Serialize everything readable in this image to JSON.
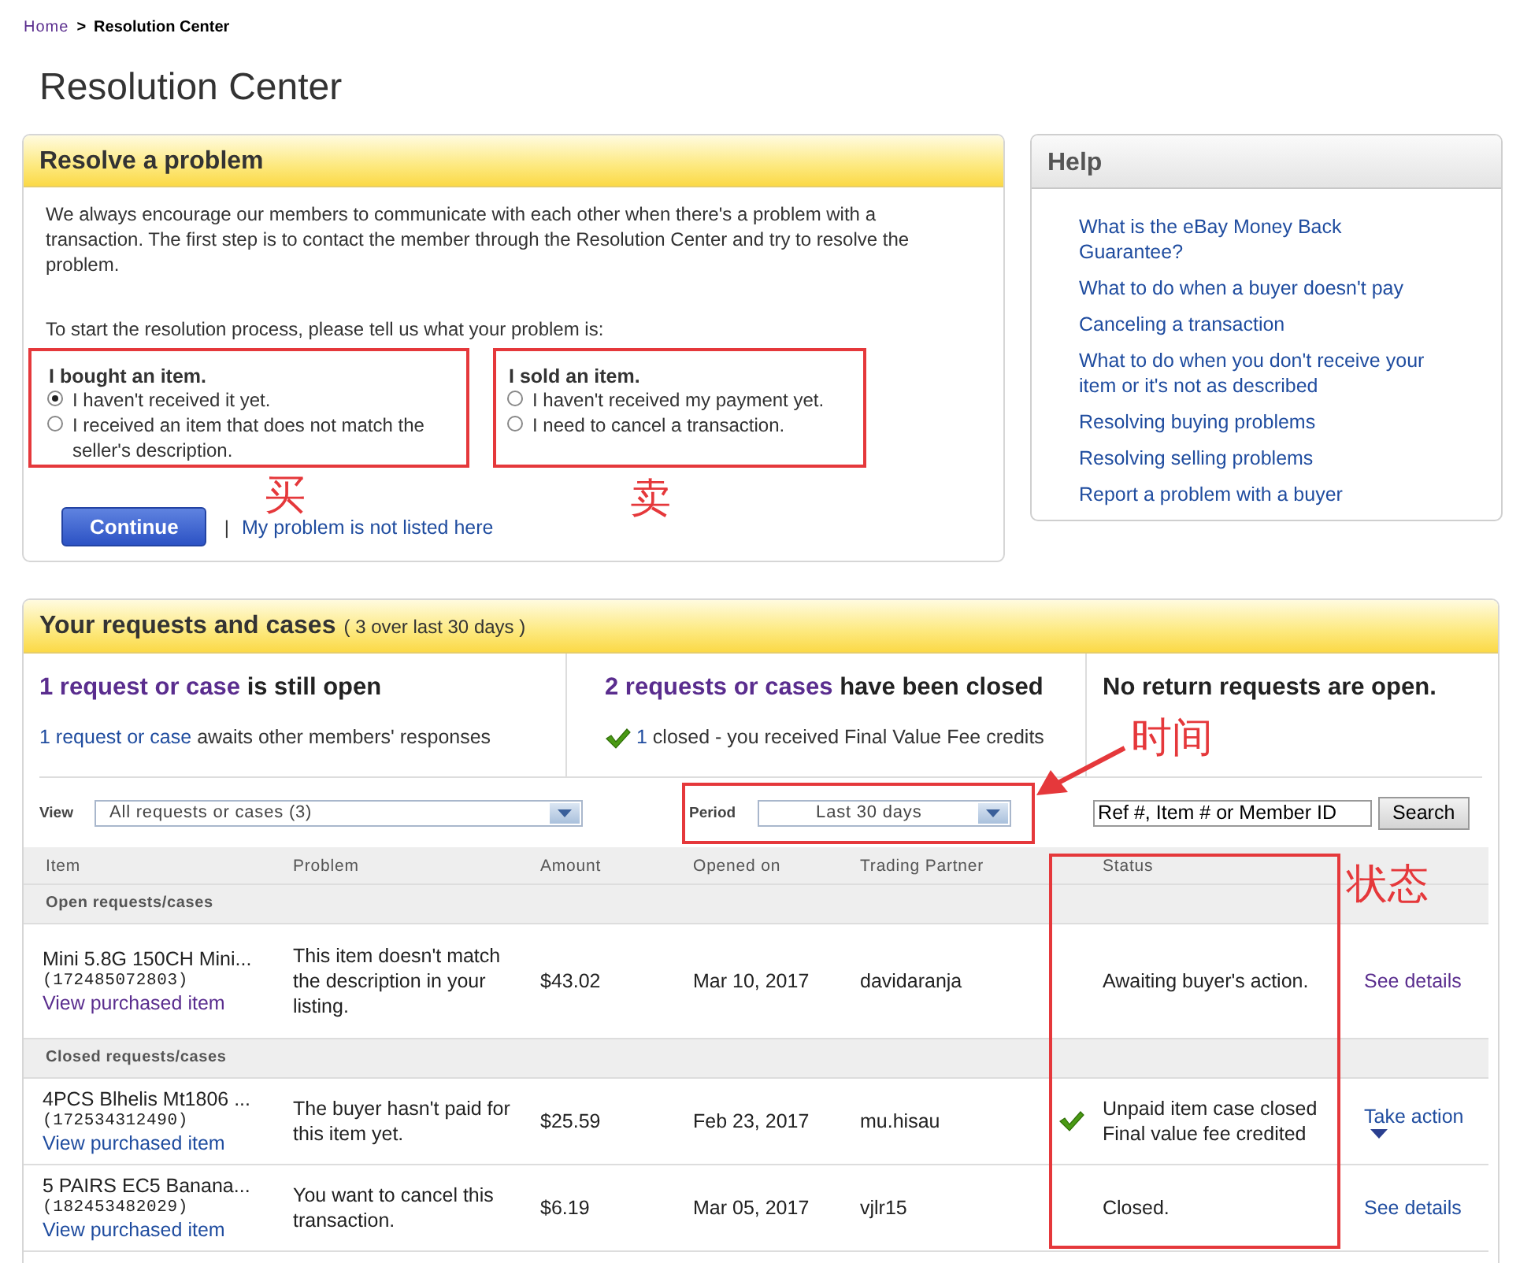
{
  "breadcrumb": [
    {
      "label": "Home",
      "kind": "link"
    },
    {
      "label": ">",
      "kind": "separator"
    },
    {
      "label": "Resolution Center",
      "kind": "current"
    }
  ],
  "page_title": "Resolution Center",
  "resolve": {
    "title": "Resolve a problem",
    "intro": "We always encourage our members to communicate with each other when there's a problem with a transaction. The first step is to contact the member through the Resolution Center and try to resolve the problem.",
    "prompt": "To start the resolution process, please tell us what your problem is:",
    "groups": [
      {
        "heading": "I bought an item.",
        "options": [
          {
            "label": "I haven't received it yet.",
            "selected": true
          },
          {
            "label": "I received an item that does not match the seller's description.",
            "selected": false
          }
        ]
      },
      {
        "heading": "I sold an item.",
        "options": [
          {
            "label": "I haven't received my payment yet.",
            "selected": false
          },
          {
            "label": "I need to cancel a transaction.",
            "selected": false
          }
        ]
      }
    ],
    "continue_button": "Continue",
    "separator": "|",
    "other_link": "My problem is not listed here"
  },
  "help": {
    "title": "Help",
    "links": [
      "What is the eBay Money Back Guarantee?",
      "What to do when a buyer doesn't pay",
      "Canceling a transaction",
      "What to do when you don't receive your item or it's not as described",
      "Resolving buying problems",
      "Resolving selling problems",
      "Report a problem with a buyer"
    ]
  },
  "cases": {
    "title": "Your requests and cases",
    "subtitle": "( 3 over last 30 days )",
    "summaries": [
      {
        "heading_link": "1 request or case",
        "heading_rest": " is still open",
        "checked": false,
        "detail_link": "1 request or case",
        "detail_rest": " awaits other members' responses"
      },
      {
        "heading_link": "2 requests or cases",
        "heading_rest": " have been closed",
        "checked": true,
        "detail_link": "1",
        "detail_rest": " closed - you received Final Value Fee credits"
      },
      {
        "heading_rest": "No return requests are open.",
        "checked": false
      }
    ],
    "view": {
      "label": "View",
      "value": "All requests or cases (3)"
    },
    "period": {
      "label": "Period",
      "value": "Last 30 days"
    },
    "search": {
      "placeholder": "Ref #, Item # or Member ID",
      "button": "Search"
    },
    "columns": [
      "Item",
      "Problem",
      "Amount",
      "Opened on",
      "Trading Partner",
      "Status"
    ],
    "groups": [
      {
        "label": "Open requests/cases",
        "rows": [
          {
            "item": "Mini 5.8G 150CH Mini...",
            "item_number": "(172485072803)",
            "item_link": "View purchased item",
            "visited": true,
            "problem": "This item doesn't match the description in your listing.",
            "amount": "$43.02",
            "opened_on": "Mar 10, 2017",
            "partner": "davidaranja",
            "checked": false,
            "status": [
              "Awaiting buyer's action."
            ],
            "action": {
              "label": "See details",
              "kind": "link",
              "visited": true
            }
          }
        ]
      },
      {
        "label": "Closed requests/cases",
        "rows": [
          {
            "item": "4PCS Blhelis Mt1806 ...",
            "item_number": "(172534312490)",
            "item_link": "View purchased item",
            "visited": false,
            "problem": "The buyer hasn't paid for this item yet.",
            "amount": "$25.59",
            "opened_on": "Feb 23, 2017",
            "partner": "mu.hisau",
            "checked": true,
            "status": [
              "Unpaid item case closed",
              "Final value fee credited"
            ],
            "action": {
              "label": "Take action",
              "kind": "menu",
              "visited": false
            }
          },
          {
            "item": "5 PAIRS EC5 Banana...",
            "item_number": "(182453482029)",
            "item_link": "View purchased item",
            "visited": false,
            "problem": "You want to cancel this transaction.",
            "amount": "$6.19",
            "opened_on": "Mar 05, 2017",
            "partner": "vjlr15",
            "checked": false,
            "status": [
              "Closed."
            ],
            "action": {
              "label": "See details",
              "kind": "link",
              "visited": false
            }
          }
        ]
      }
    ]
  },
  "annotations": [
    {
      "text": "买"
    },
    {
      "text": "卖"
    },
    {
      "text": "时间"
    },
    {
      "text": "状态"
    }
  ]
}
